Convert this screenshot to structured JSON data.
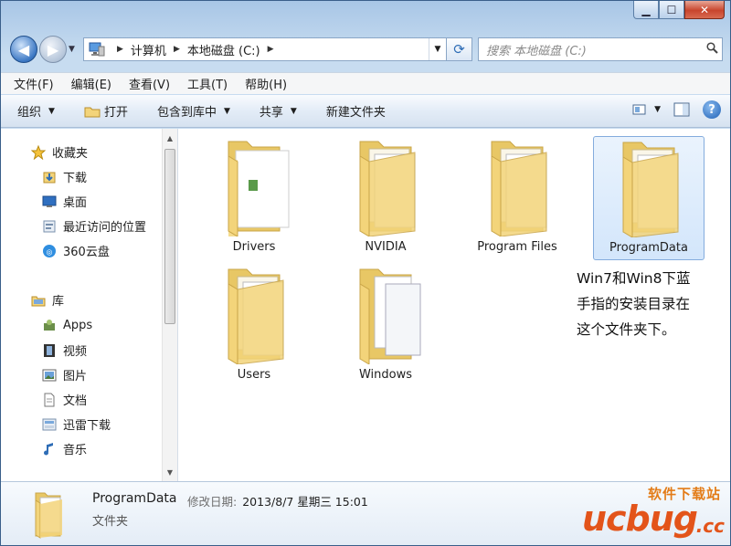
{
  "window": {
    "minimize_glyph": "▁",
    "maximize_glyph": "☐",
    "close_glyph": "✕"
  },
  "nav": {
    "back_glyph": "◀",
    "forward_glyph": "▶"
  },
  "address": {
    "crumbs": [
      "计算机",
      "本地磁盘 (C:)"
    ]
  },
  "search": {
    "placeholder": "搜索 本地磁盘 (C:)"
  },
  "menu": [
    "文件(F)",
    "编辑(E)",
    "查看(V)",
    "工具(T)",
    "帮助(H)"
  ],
  "toolbar": {
    "organize": "组织",
    "open": "打开",
    "include_library": "包含到库中",
    "share": "共享",
    "new_folder": "新建文件夹"
  },
  "sidebar": {
    "favorites": {
      "label": "收藏夹",
      "items": [
        "下载",
        "桌面",
        "最近访问的位置",
        "360云盘"
      ]
    },
    "libraries": {
      "label": "库",
      "items": [
        "Apps",
        "视频",
        "图片",
        "文档",
        "迅雷下载",
        "音乐"
      ]
    }
  },
  "folders": [
    {
      "name": "Drivers",
      "selected": false
    },
    {
      "name": "NVIDIA",
      "selected": false
    },
    {
      "name": "Program Files",
      "selected": false
    },
    {
      "name": "ProgramData",
      "selected": true
    },
    {
      "name": "Users",
      "selected": false
    },
    {
      "name": "Windows",
      "selected": false
    }
  ],
  "annotation": {
    "lines": [
      "Win7和Win8下蓝",
      "手指的安装目录在",
      "这个文件夹下。"
    ]
  },
  "details": {
    "name": "ProgramData",
    "modified_label": "修改日期:",
    "modified_value": "2013/8/7 星期三 15:01",
    "type": "文件夹"
  },
  "watermark": {
    "top": "软件下载站",
    "brand": "ucbug",
    "suffix": ".cc"
  },
  "colors": {
    "folder": "#f3d47a",
    "selection": "#d3e6fb",
    "watermark": "#e3541a"
  }
}
